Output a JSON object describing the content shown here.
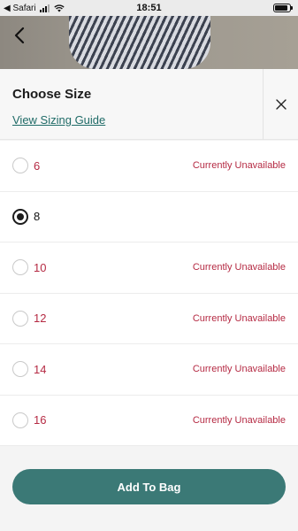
{
  "status_bar": {
    "back_app": "◀ Safari",
    "time": "18:51",
    "battery_level": 0.75
  },
  "product": {
    "image_name": "striped-skirt-image"
  },
  "sheet": {
    "title": "Choose Size",
    "sizing_link": "View Sizing Guide"
  },
  "sizes": [
    {
      "label": "6",
      "status": "Currently Unavailable",
      "selected": false
    },
    {
      "label": "8",
      "status": "",
      "selected": true
    },
    {
      "label": "10",
      "status": "Currently Unavailable",
      "selected": false
    },
    {
      "label": "12",
      "status": "Currently Unavailable",
      "selected": false
    },
    {
      "label": "14",
      "status": "Currently Unavailable",
      "selected": false
    },
    {
      "label": "16",
      "status": "Currently Unavailable",
      "selected": false
    }
  ],
  "footer": {
    "add_label": "Add To Bag"
  },
  "colors": {
    "accent": "#3b7976",
    "unavailable": "#b52a43",
    "link": "#1f6b67"
  }
}
